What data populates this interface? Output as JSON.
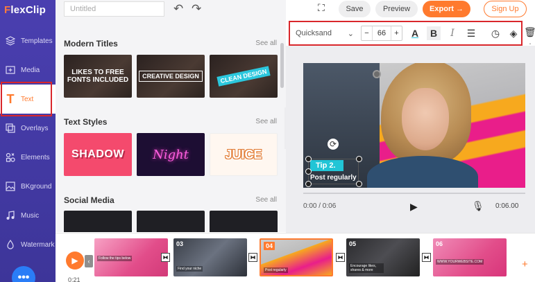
{
  "app": {
    "logo_prefix": "F",
    "logo_rest": "lexClip"
  },
  "sidebar": {
    "items": [
      {
        "label": "Templates",
        "icon": "layers-icon"
      },
      {
        "label": "Media",
        "icon": "media-plus-icon"
      },
      {
        "label": "Text",
        "icon": "text-t-icon",
        "active": true
      },
      {
        "label": "Overlays",
        "icon": "overlays-icon"
      },
      {
        "label": "Elements",
        "icon": "elements-icon"
      },
      {
        "label": "BKground",
        "icon": "background-icon"
      },
      {
        "label": "Music",
        "icon": "music-note-icon"
      },
      {
        "label": "Watermark",
        "icon": "watermark-icon"
      }
    ],
    "chat_glyph": "•••"
  },
  "header": {
    "project_placeholder": "Untitled",
    "undo_glyph": "↶",
    "redo_glyph": "↷",
    "fullscreen_glyph": "⛶",
    "save_label": "Save",
    "preview_label": "Preview",
    "export_label": "Export →",
    "signup_label": "Sign Up"
  },
  "library": {
    "sections": [
      {
        "title": "Modern Titles",
        "see_all": "See all",
        "thumbs": [
          "LIKES TO FREE FONTS INCLUDED",
          "CREATIVE DESIGN",
          "CLEAN DESIGN"
        ]
      },
      {
        "title": "Text Styles",
        "see_all": "See all",
        "thumbs": [
          "SHADOW",
          "Night",
          "JUICE"
        ]
      },
      {
        "title": "Social Media",
        "see_all": "See all",
        "thumbs": []
      }
    ],
    "collapse_glyph": "‹"
  },
  "toolbar": {
    "font": "Quicksand",
    "font_chevron": "⌄",
    "minus": "−",
    "size": "66",
    "plus": "+",
    "color_glyph": "A",
    "bold_glyph": "B",
    "italic_glyph": "I",
    "align_glyph": "☰",
    "clock_glyph": "◷",
    "layers_glyph": "◈",
    "trash_glyph": "🗑",
    "more_glyph": "⋮"
  },
  "canvas": {
    "tip_badge": "Tip 2.",
    "tip_text": "Post regularly",
    "rotate_glyph": "⟳"
  },
  "player": {
    "time_current": "0:00 / 0:06",
    "play_glyph": "▶",
    "mic_glyph": "🎙",
    "time_total": "0:06.00"
  },
  "timeline": {
    "play_glyph": "▶",
    "back_glyph": "‹",
    "time": "0:21",
    "transition_glyph": "⧓",
    "add_glyph": "+",
    "scenes": [
      {
        "num": "",
        "caption": "Follow the tips below"
      },
      {
        "num": "03",
        "caption": "Find your niche"
      },
      {
        "num": "04",
        "caption": "Post regularly",
        "selected": true
      },
      {
        "num": "05",
        "caption": "Encourage likes, shares & more"
      },
      {
        "num": "06",
        "caption": "WWW.YOURWEBSITE.COM"
      }
    ]
  },
  "colors": {
    "accent": "#ff7a2e",
    "sidebar": "#4a3fb0",
    "highlight_box": "#d9262b",
    "tip": "#21c5d6"
  }
}
